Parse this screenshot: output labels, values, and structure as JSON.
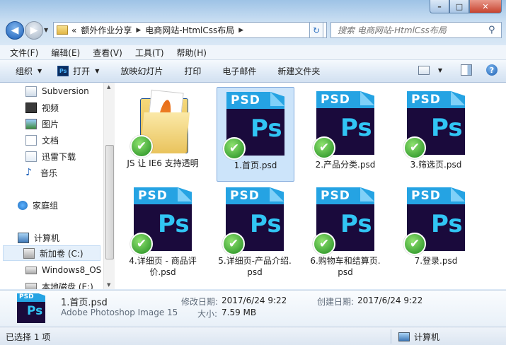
{
  "window": {
    "min_label": "–",
    "max_label": "□",
    "close_label": "✕"
  },
  "address": {
    "prefix": "«",
    "crumbs": [
      "额外作业分享",
      "电商网站-HtmlCss布局"
    ]
  },
  "search": {
    "placeholder": "搜索 电商网站-HtmlCss布局"
  },
  "menu": [
    "文件(F)",
    "编辑(E)",
    "查看(V)",
    "工具(T)",
    "帮助(H)"
  ],
  "toolbar": {
    "organize": "组织",
    "open": "打开",
    "slideshow": "放映幻灯片",
    "print": "打印",
    "email": "电子邮件",
    "new_folder": "新建文件夹"
  },
  "nav": {
    "subversion": "Subversion",
    "video": "视频",
    "pictures": "图片",
    "documents": "文档",
    "thunder": "迅雷下载",
    "music": "音乐",
    "homegroup": "家庭组",
    "computer": "计算机",
    "drive_c": "新加卷 (C:)",
    "drive_win8": "Windows8_OS (",
    "drive_e": "本地磁盘 (E:)"
  },
  "files": [
    {
      "name": "JS 让 IE6 支持透明",
      "kind": "folder"
    },
    {
      "name": "1.首页.psd",
      "kind": "psd",
      "selected": true
    },
    {
      "name": "2.产品分类.psd",
      "kind": "psd"
    },
    {
      "name": "3.筛选页.psd",
      "kind": "psd"
    },
    {
      "name": "4.详细页 - 商品评价.psd",
      "kind": "psd"
    },
    {
      "name": "5.详细页-产品介绍.psd",
      "kind": "psd"
    },
    {
      "name": "6.购物车和结算页.psd",
      "kind": "psd"
    },
    {
      "name": "7.登录.psd",
      "kind": "psd"
    }
  ],
  "icon_text": {
    "psd": "PSD",
    "ps": "Ps",
    "check": "✔"
  },
  "details": {
    "name": "1.首页.psd",
    "type": "Adobe Photoshop Image 15",
    "modified_label": "修改日期:",
    "modified_value": "2017/6/24 9:22",
    "created_label": "创建日期:",
    "created_value": "2017/6/24 9:22",
    "size_label": "大小:",
    "size_value": "7.59 MB"
  },
  "status": {
    "selected": "已选择 1 项",
    "location": "计算机"
  },
  "colors": {
    "accent": "#25a3e3",
    "ps_dark": "#1a0a3c",
    "selection": "#cce4fa"
  }
}
